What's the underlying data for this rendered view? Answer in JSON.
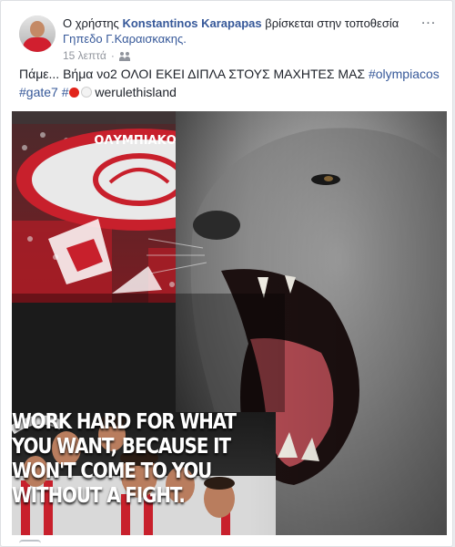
{
  "post": {
    "prefix": "Ο χρήστης",
    "author": "Konstantinos Karapapas",
    "location_phrase": "βρίσκεται στην τοποθεσία",
    "place": "Γηπεδο Γ.Καραισκακης.",
    "time": "15 λεπτά",
    "separator": "·",
    "audience_icon": "friends-icon",
    "text": "Πάμε... Βήμα νο2 ΟΛΟΙ ΕΚΕΙ ΔΙΠΛΑ ΣΤΟΥΣ ΜΑΧΗΤΕΣ ΜΑΣ",
    "hashtags": [
      "#olympiacos",
      "#gate7",
      "#"
    ],
    "trailing_text": "werulethisland",
    "menu_label": "..."
  },
  "image": {
    "club_banner": "ΟΛΥΜΠΙΑΚΟΣ",
    "quote_lines": [
      "WORK HARD FOR WHAT",
      "YOU WANT, BECAUSE IT",
      "WON'T COME TO YOU",
      "WITHOUT A FIGHT."
    ]
  },
  "colors": {
    "link": "#365899",
    "text": "#1d2129",
    "meta": "#90949c",
    "olympiacos_red": "#d11f2f"
  }
}
